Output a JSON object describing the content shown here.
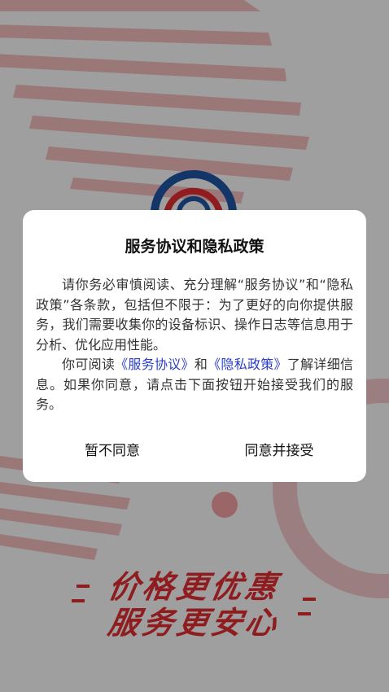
{
  "background": {
    "slogan_line1": "价格更优惠",
    "slogan_line2": "服务更安心",
    "accent_color": "#d62a2f",
    "logo_icon": "app-logo-icon"
  },
  "dialog": {
    "title": "服务协议和隐私政策",
    "para1": "请你务必审慎阅读、充分理解“服务协议”和“隐私政策”各条款，包括但不限于：为了更好的向你提供服务，我们需要收集你的设备标识、操作日志等信息用于分析、优化应用性能。",
    "para2_prefix": "你可阅读",
    "service_link": "《服务协议》",
    "para2_and": "和",
    "privacy_link": "《隐私政策》",
    "para2_suffix": "了解详细信息。如果你同意，请点击下面按钮开始接受我们的服务。",
    "disagree_label": "暂不同意",
    "agree_label": "同意并接受",
    "link_color": "#2a3ec7"
  }
}
